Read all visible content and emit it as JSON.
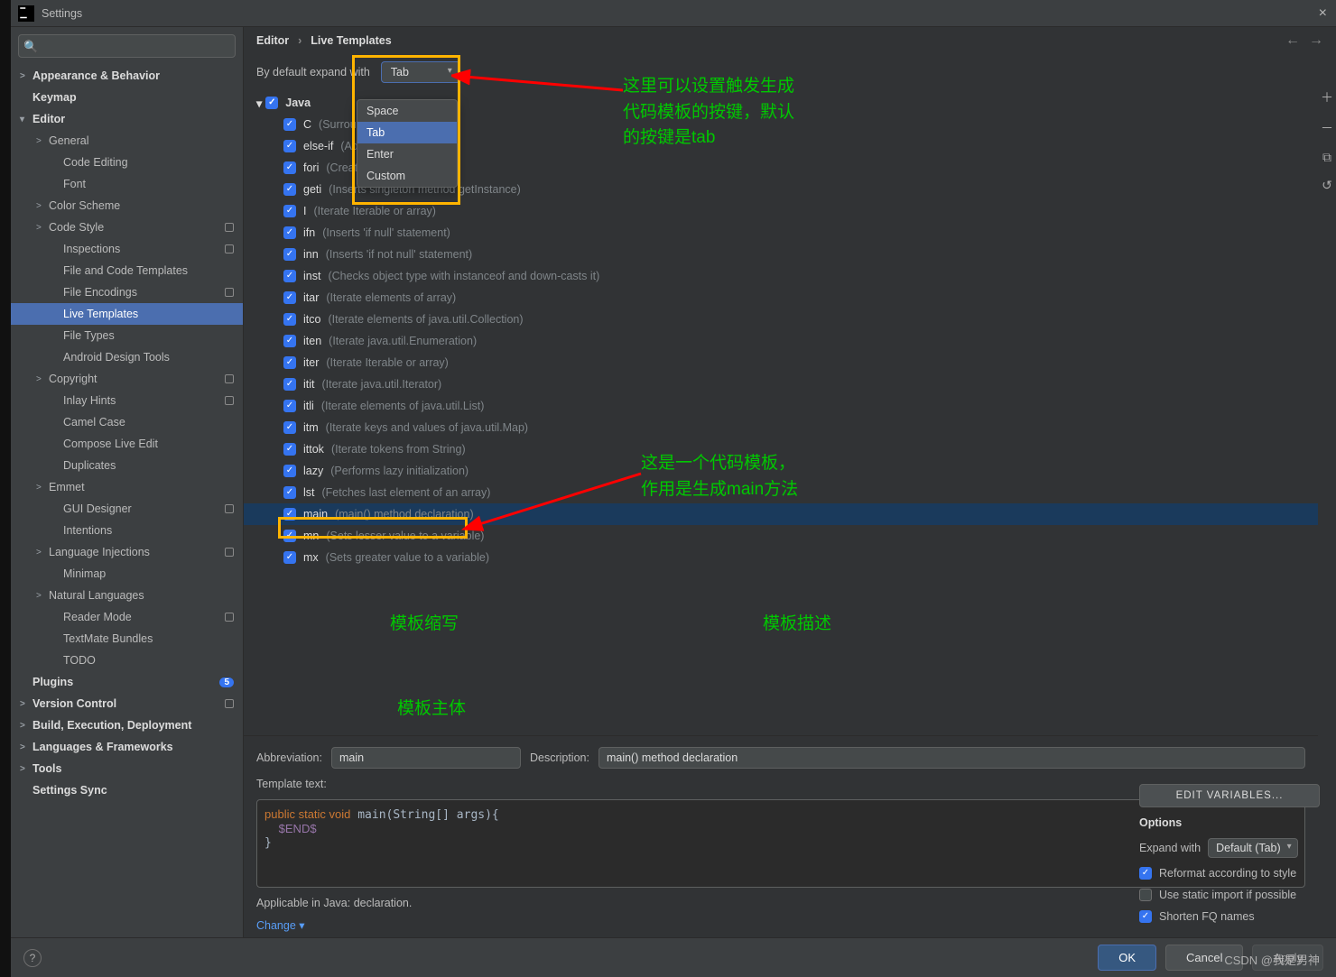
{
  "window": {
    "title": "Settings"
  },
  "search": {
    "placeholder": ""
  },
  "sidebar": {
    "items": [
      {
        "label": "Appearance & Behavior",
        "bold": true,
        "chev": ">",
        "ind": 0
      },
      {
        "label": "Keymap",
        "bold": true,
        "ind": 0
      },
      {
        "label": "Editor",
        "bold": true,
        "chev": "▾",
        "ind": 0
      },
      {
        "label": "General",
        "chev": ">",
        "ind": 1
      },
      {
        "label": "Code Editing",
        "ind": 2
      },
      {
        "label": "Font",
        "ind": 2
      },
      {
        "label": "Color Scheme",
        "chev": ">",
        "ind": 1
      },
      {
        "label": "Code Style",
        "chev": ">",
        "ind": 1,
        "reset": true
      },
      {
        "label": "Inspections",
        "ind": 2,
        "reset": true
      },
      {
        "label": "File and Code Templates",
        "ind": 2
      },
      {
        "label": "File Encodings",
        "ind": 2,
        "reset": true
      },
      {
        "label": "Live Templates",
        "ind": 2,
        "selected": true
      },
      {
        "label": "File Types",
        "ind": 2
      },
      {
        "label": "Android Design Tools",
        "ind": 2
      },
      {
        "label": "Copyright",
        "chev": ">",
        "ind": 1,
        "reset": true
      },
      {
        "label": "Inlay Hints",
        "ind": 2,
        "reset": true
      },
      {
        "label": "Camel Case",
        "ind": 2
      },
      {
        "label": "Compose Live Edit",
        "ind": 2
      },
      {
        "label": "Duplicates",
        "ind": 2
      },
      {
        "label": "Emmet",
        "chev": ">",
        "ind": 1
      },
      {
        "label": "GUI Designer",
        "ind": 2,
        "reset": true
      },
      {
        "label": "Intentions",
        "ind": 2
      },
      {
        "label": "Language Injections",
        "chev": ">",
        "ind": 1,
        "reset": true
      },
      {
        "label": "Minimap",
        "ind": 2
      },
      {
        "label": "Natural Languages",
        "chev": ">",
        "ind": 1
      },
      {
        "label": "Reader Mode",
        "ind": 2,
        "reset": true
      },
      {
        "label": "TextMate Bundles",
        "ind": 2
      },
      {
        "label": "TODO",
        "ind": 2
      },
      {
        "label": "Plugins",
        "bold": true,
        "ind": 0,
        "pluginCount": "5"
      },
      {
        "label": "Version Control",
        "bold": true,
        "chev": ">",
        "ind": 0,
        "reset": true
      },
      {
        "label": "Build, Execution, Deployment",
        "bold": true,
        "chev": ">",
        "ind": 0
      },
      {
        "label": "Languages & Frameworks",
        "bold": true,
        "chev": ">",
        "ind": 0
      },
      {
        "label": "Tools",
        "bold": true,
        "chev": ">",
        "ind": 0
      },
      {
        "label": "Settings Sync",
        "bold": true,
        "ind": 0
      }
    ]
  },
  "breadcrumb": {
    "parent": "Editor",
    "sep": "›",
    "current": "Live Templates"
  },
  "expand": {
    "label": "By default expand with",
    "value": "Tab",
    "options": [
      "Space",
      "Tab",
      "Enter",
      "Custom"
    ]
  },
  "group": {
    "name": "Java"
  },
  "templates": [
    {
      "abbr": "C",
      "desc": "(Surround with Callable)"
    },
    {
      "abbr": "else-if",
      "desc": "(Add else-if branch)"
    },
    {
      "abbr": "fori",
      "desc": "(Create iteration loop)"
    },
    {
      "abbr": "geti",
      "desc": "(Inserts singleton method getInstance)"
    },
    {
      "abbr": "I",
      "desc": "(Iterate Iterable or array)"
    },
    {
      "abbr": "ifn",
      "desc": "(Inserts 'if null' statement)"
    },
    {
      "abbr": "inn",
      "desc": "(Inserts 'if not null' statement)"
    },
    {
      "abbr": "inst",
      "desc": "(Checks object type with instanceof and down-casts it)"
    },
    {
      "abbr": "itar",
      "desc": "(Iterate elements of array)"
    },
    {
      "abbr": "itco",
      "desc": "(Iterate elements of java.util.Collection)"
    },
    {
      "abbr": "iten",
      "desc": "(Iterate java.util.Enumeration)"
    },
    {
      "abbr": "iter",
      "desc": "(Iterate Iterable or array)"
    },
    {
      "abbr": "itit",
      "desc": "(Iterate java.util.Iterator)"
    },
    {
      "abbr": "itli",
      "desc": "(Iterate elements of java.util.List)"
    },
    {
      "abbr": "itm",
      "desc": "(Iterate keys and values of java.util.Map)"
    },
    {
      "abbr": "ittok",
      "desc": "(Iterate tokens from String)"
    },
    {
      "abbr": "lazy",
      "desc": "(Performs lazy initialization)"
    },
    {
      "abbr": "lst",
      "desc": "(Fetches last element of an array)"
    },
    {
      "abbr": "main",
      "desc": "(main() method declaration)",
      "selected": true
    },
    {
      "abbr": "mn",
      "desc": "(Sets lesser value to a variable)"
    },
    {
      "abbr": "mx",
      "desc": "(Sets greater value to a variable)"
    }
  ],
  "editor": {
    "abbrevLabel": "Abbreviation:",
    "abbrevValue": "main",
    "descLabel": "Description:",
    "descValue": "main() method declaration",
    "textLabel": "Template text:",
    "applicable": "Applicable in Java: declaration.",
    "changeLabel": "Change",
    "editVars": "EDIT VARIABLES...",
    "optionsLabel": "Options",
    "expandWithLabel": "Expand with",
    "expandWithValue": "Default (Tab)",
    "opt1": "Reformat according to style",
    "opt2": "Use static import if possible",
    "opt3": "Shorten FQ names"
  },
  "footer": {
    "ok": "OK",
    "cancel": "Cancel",
    "apply": "Apply"
  },
  "annotations": {
    "a1": "这里可以设置触发生成\n代码模板的按键，默认\n的按键是tab",
    "a2": "这是一个代码模板，\n作用是生成main方法",
    "a3": "模板缩写",
    "a4": "模板描述",
    "a5": "模板主体"
  },
  "watermark": "CSDN @我是男神"
}
